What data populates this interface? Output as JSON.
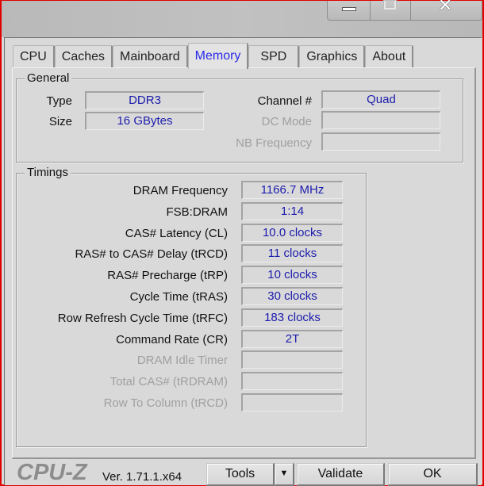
{
  "window": {
    "caption_buttons": {
      "minimize": "minimize-icon",
      "maximize": "maximize-icon",
      "close": "close-icon"
    }
  },
  "tabs": [
    {
      "label": "CPU",
      "active": false
    },
    {
      "label": "Caches",
      "active": false
    },
    {
      "label": "Mainboard",
      "active": false
    },
    {
      "label": "Memory",
      "active": true
    },
    {
      "label": "SPD",
      "active": false
    },
    {
      "label": "Graphics",
      "active": false
    },
    {
      "label": "About",
      "active": false
    }
  ],
  "general": {
    "title": "General",
    "type_label": "Type",
    "type_value": "DDR3",
    "size_label": "Size",
    "size_value": "16 GBytes",
    "channel_label": "Channel #",
    "channel_value": "Quad",
    "dc_mode_label": "DC Mode",
    "dc_mode_value": "",
    "nb_frequency_label": "NB Frequency",
    "nb_frequency_value": ""
  },
  "timings": {
    "title": "Timings",
    "rows": [
      {
        "label": "DRAM Frequency",
        "value": "1166.7 MHz",
        "enabled": true
      },
      {
        "label": "FSB:DRAM",
        "value": "1:14",
        "enabled": true
      },
      {
        "label": "CAS# Latency (CL)",
        "value": "10.0 clocks",
        "enabled": true
      },
      {
        "label": "RAS# to CAS# Delay (tRCD)",
        "value": "11 clocks",
        "enabled": true
      },
      {
        "label": "RAS# Precharge (tRP)",
        "value": "10 clocks",
        "enabled": true
      },
      {
        "label": "Cycle Time (tRAS)",
        "value": "30 clocks",
        "enabled": true
      },
      {
        "label": "Row Refresh Cycle Time (tRFC)",
        "value": "183 clocks",
        "enabled": true
      },
      {
        "label": "Command Rate (CR)",
        "value": "2T",
        "enabled": true
      },
      {
        "label": "DRAM Idle Timer",
        "value": "",
        "enabled": false
      },
      {
        "label": "Total CAS# (tRDRAM)",
        "value": "",
        "enabled": false
      },
      {
        "label": "Row To Column (tRCD)",
        "value": "",
        "enabled": false
      }
    ]
  },
  "footer": {
    "logo": "CPU-Z",
    "version": "Ver. 1.71.1.x64",
    "tools_label": "Tools",
    "tools_arrow": "▼",
    "validate_label": "Validate",
    "ok_label": "OK"
  },
  "colors": {
    "value_text": "#1c1cad",
    "active_tab_text": "#2a2aeb",
    "window_border": "#e00000"
  }
}
